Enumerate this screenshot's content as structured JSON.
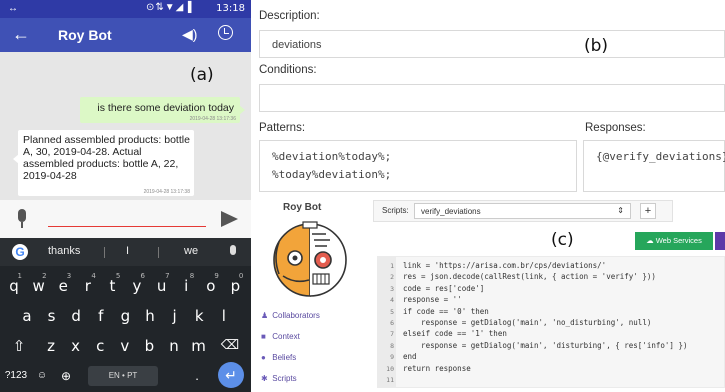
{
  "phone": {
    "status_bar": {
      "left_icon": "↔",
      "icons": "⊙⇅▼◢▐",
      "time": "13:18"
    },
    "app_bar": {
      "title": "Roy Bot",
      "back_icon": "←",
      "volume_icon": "◀)"
    },
    "panel_label": "(a)",
    "chat": {
      "outgoing": {
        "text": "is there some deviation today",
        "time": "2019-04-28 13:17:36"
      },
      "incoming": {
        "text": "Planned assembled products: bottle A, 30, 2019-04-28. Actual assembled products: bottle A, 22, 2019-04-28",
        "time": "2019-04-28 13:17:38"
      }
    },
    "keyboard": {
      "suggestions": [
        "thanks",
        "I",
        "we"
      ],
      "row1": [
        {
          "k": "q",
          "n": "1"
        },
        {
          "k": "w",
          "n": "2"
        },
        {
          "k": "e",
          "n": "3"
        },
        {
          "k": "r",
          "n": "4"
        },
        {
          "k": "t",
          "n": "5"
        },
        {
          "k": "y",
          "n": "6"
        },
        {
          "k": "u",
          "n": "7"
        },
        {
          "k": "i",
          "n": "8"
        },
        {
          "k": "o",
          "n": "9"
        },
        {
          "k": "p",
          "n": "0"
        }
      ],
      "row2": [
        "a",
        "s",
        "d",
        "f",
        "g",
        "h",
        "j",
        "k",
        "l"
      ],
      "row3": [
        "z",
        "x",
        "c",
        "v",
        "b",
        "n",
        "m"
      ],
      "shift": "⇧",
      "backspace": "⌫",
      "sym_key": "?123",
      "comma_key": "☺",
      "globe_key": "⊕",
      "space_label": "EN • PT",
      "period_key": ".",
      "enter": "↵"
    }
  },
  "panel_b": {
    "panel_label": "(b)",
    "description_label": "Description:",
    "description_value": "deviations",
    "conditions_label": "Conditions:",
    "conditions_value": "",
    "patterns_label": "Patterns:",
    "patterns": [
      "%deviation%today%;",
      "%today%deviation%;"
    ],
    "responses_label": "Responses:",
    "responses_value": "{@verify_deviations};"
  },
  "panel_c": {
    "panel_label": "(c)",
    "bot_title": "Roy Bot",
    "scripts_label": "Scripts:",
    "scripts_selected": "verify_deviations",
    "add_label": "+",
    "web_services_label": "Web Services",
    "sidebar": [
      {
        "icon": "users-icon",
        "glyph": "♟",
        "label": "Collaborators"
      },
      {
        "icon": "context-icon",
        "glyph": "■",
        "label": "Context"
      },
      {
        "icon": "beliefs-icon",
        "glyph": "●",
        "label": "Beliefs"
      },
      {
        "icon": "scripts-icon",
        "glyph": "✱",
        "label": "Scripts"
      }
    ],
    "code_lines": [
      "link = 'https://arisa.com.br/cps/deviations/'",
      "res = json.decode(callRest(link, { action = 'verify' }))",
      "code = res['code']",
      "response = ''",
      "if code == '0' then",
      "    response = getDialog('main', 'no_disturbing', null)",
      "elseif code == '1' then",
      "    response = getDialog('main', 'disturbing', { res['info'] })",
      "end",
      "return response",
      ""
    ],
    "colors": {
      "web_services": "#26a65b",
      "accent": "#5d3aa8"
    }
  }
}
